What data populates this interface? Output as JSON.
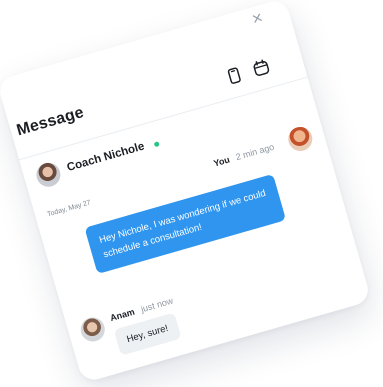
{
  "window": {
    "title": "Message",
    "close_icon": "close-icon"
  },
  "header": {
    "actions": [
      {
        "icon": "phone-icon"
      },
      {
        "icon": "calendar-icon"
      }
    ]
  },
  "contact": {
    "name": "Coach Nichole",
    "status_color": "#2bc487"
  },
  "conversation": {
    "date_label": "Today, May 27",
    "messages": [
      {
        "sender": "You",
        "time": "2 min ago",
        "text": "Hey Nichole, I was wondering if we could schedule a consultation!",
        "bubble_color": "#2f95ef"
      },
      {
        "sender": "Anam",
        "time": "just now",
        "text": "Hey, sure!",
        "bubble_color": "#eef1f4"
      }
    ]
  }
}
